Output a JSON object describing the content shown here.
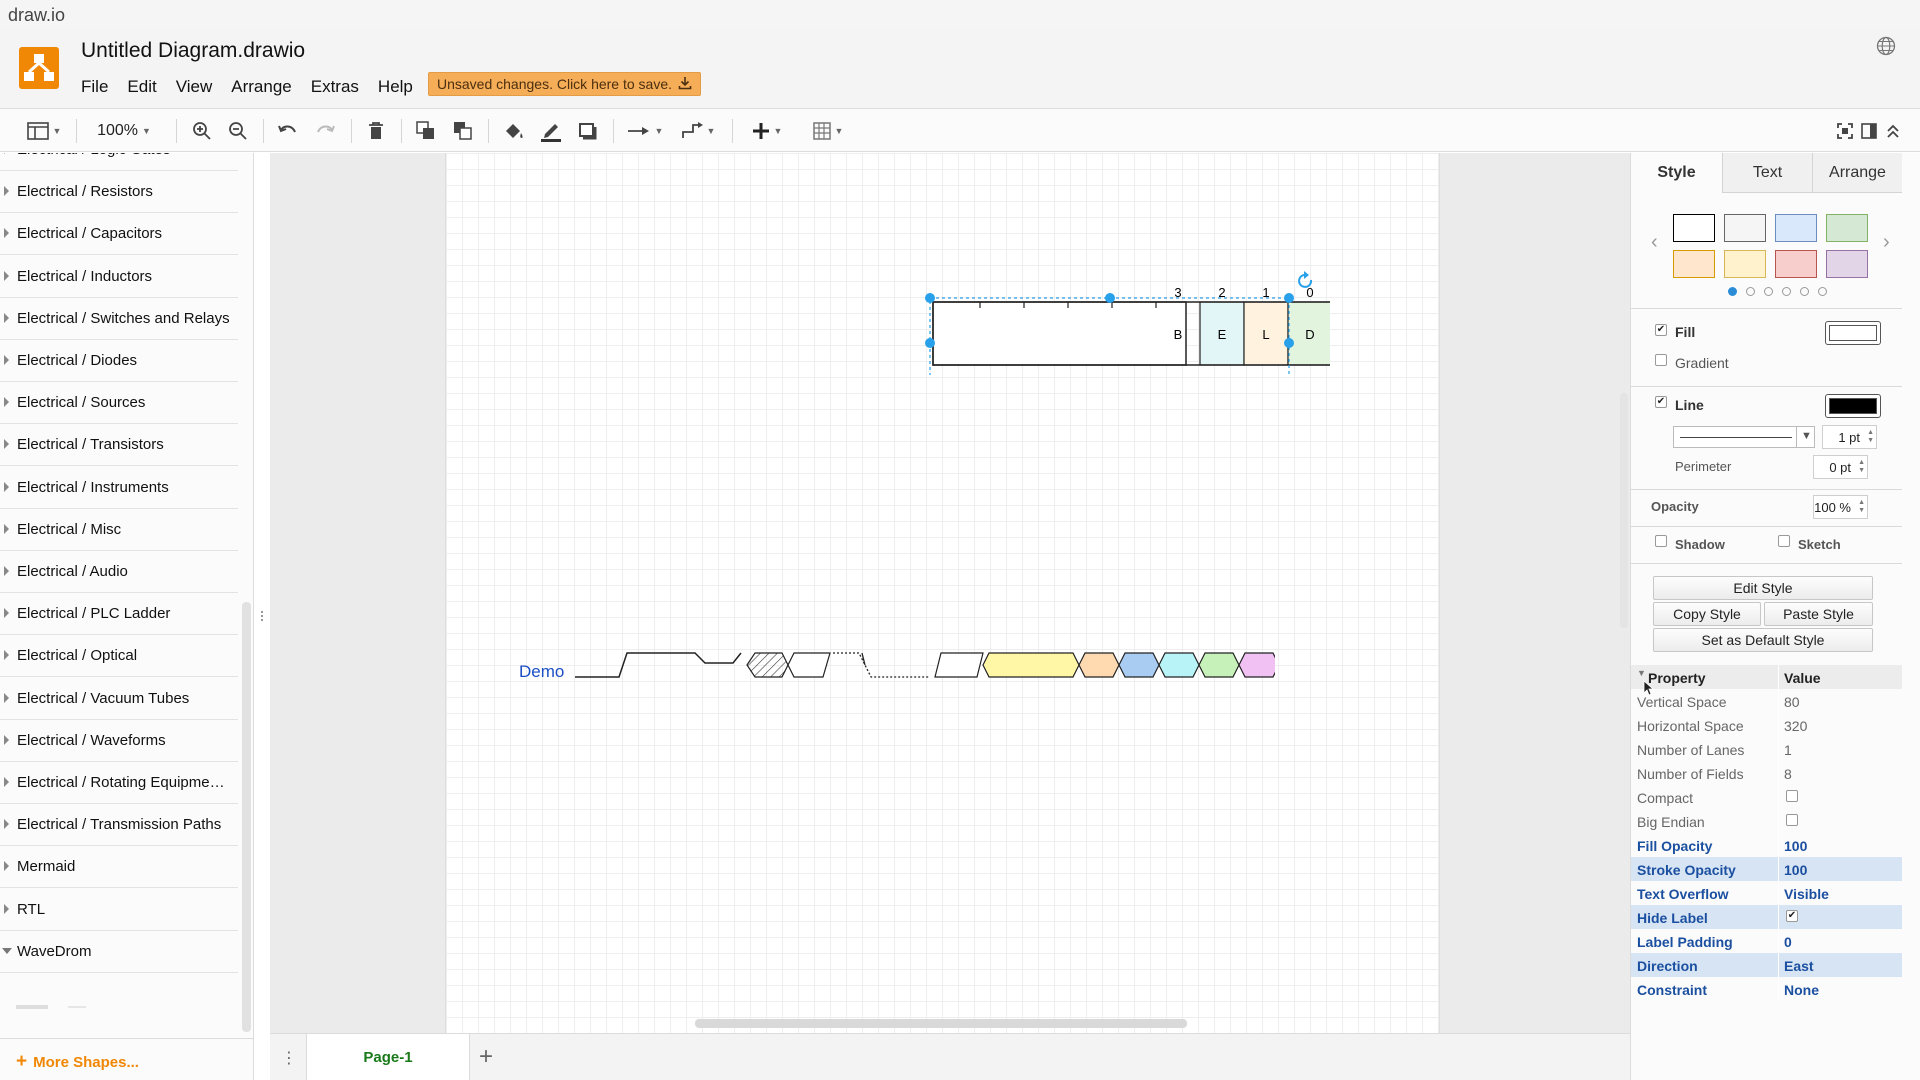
{
  "window": {
    "title": "draw.io"
  },
  "header": {
    "doc_title": "Untitled Diagram.drawio",
    "menu": [
      "File",
      "Edit",
      "View",
      "Arrange",
      "Extras",
      "Help"
    ],
    "unsaved_label": "Unsaved changes. Click here to save."
  },
  "toolbar": {
    "zoom": "100%"
  },
  "sidebar": {
    "items": [
      "Electrical / Logic Gates",
      "Electrical / Resistors",
      "Electrical / Capacitors",
      "Electrical / Inductors",
      "Electrical / Switches and Relays",
      "Electrical / Diodes",
      "Electrical / Sources",
      "Electrical / Transistors",
      "Electrical / Instruments",
      "Electrical / Misc",
      "Electrical / Audio",
      "Electrical / PLC Ladder",
      "Electrical / Optical",
      "Electrical / Vacuum Tubes",
      "Electrical / Waveforms",
      "Electrical / Rotating Equipme…",
      "Electrical / Transmission Paths",
      "Mermaid",
      "RTL",
      "WaveDrom"
    ],
    "more_shapes": "More Shapes..."
  },
  "canvas": {
    "bitfield": {
      "bit_numbers": [
        "3",
        "2",
        "1",
        "0"
      ],
      "fields": [
        "B",
        "E",
        "L",
        "D"
      ],
      "field_colors": [
        "#ffffff",
        "#e3f6f7",
        "#fff3df",
        "#e2f3de"
      ]
    },
    "wave": {
      "label": "Demo",
      "label_color": "#1a4fc4",
      "segment_colors": [
        "#fff7a6",
        "#ffd9b0",
        "#a9ccf3",
        "#b7f3f7",
        "#c6f2b9",
        "#f0c1f2",
        "#f7c2bf"
      ]
    }
  },
  "pages": {
    "active": "Page-1"
  },
  "format_panel": {
    "tabs": [
      "Style",
      "Text",
      "Arrange"
    ],
    "swatches": [
      "#ffffff",
      "#f5f5f5",
      "#dae8fc",
      "#d5e8d4",
      "#ffe6cc",
      "#fff2cc",
      "#f8cecc",
      "#e1d5e7"
    ],
    "swatch_borders": [
      "#000000",
      "#666666",
      "#6c8ebf",
      "#82b366",
      "#d79b00",
      "#d6b656",
      "#b85450",
      "#9673a6"
    ],
    "fill_label": "Fill",
    "gradient_label": "Gradient",
    "line_label": "Line",
    "line_width": "1 pt",
    "perimeter_label": "Perimeter",
    "perimeter_value": "0 pt",
    "opacity_label": "Opacity",
    "opacity_value": "100 %",
    "shadow_label": "Shadow",
    "sketch_label": "Sketch",
    "buttons": {
      "edit_style": "Edit Style",
      "copy_style": "Copy Style",
      "paste_style": "Paste Style",
      "set_default": "Set as Default Style"
    },
    "properties": {
      "header_key": "Property",
      "header_value": "Value",
      "rows": [
        {
          "key": "Vertical Space",
          "value": "80"
        },
        {
          "key": "Horizontal Space",
          "value": "320"
        },
        {
          "key": "Number of Lanes",
          "value": "1"
        },
        {
          "key": "Number of Fields",
          "value": "8"
        },
        {
          "key": "Compact",
          "value": ""
        },
        {
          "key": "Big Endian",
          "value": ""
        },
        {
          "key": "Fill Opacity",
          "value": "100"
        },
        {
          "key": "Stroke Opacity",
          "value": "100"
        },
        {
          "key": "Text Overflow",
          "value": "Visible"
        },
        {
          "key": "Hide Label",
          "value": ""
        },
        {
          "key": "Label Padding",
          "value": "0"
        },
        {
          "key": "Direction",
          "value": "East"
        },
        {
          "key": "Constraint",
          "value": "None"
        }
      ]
    }
  }
}
